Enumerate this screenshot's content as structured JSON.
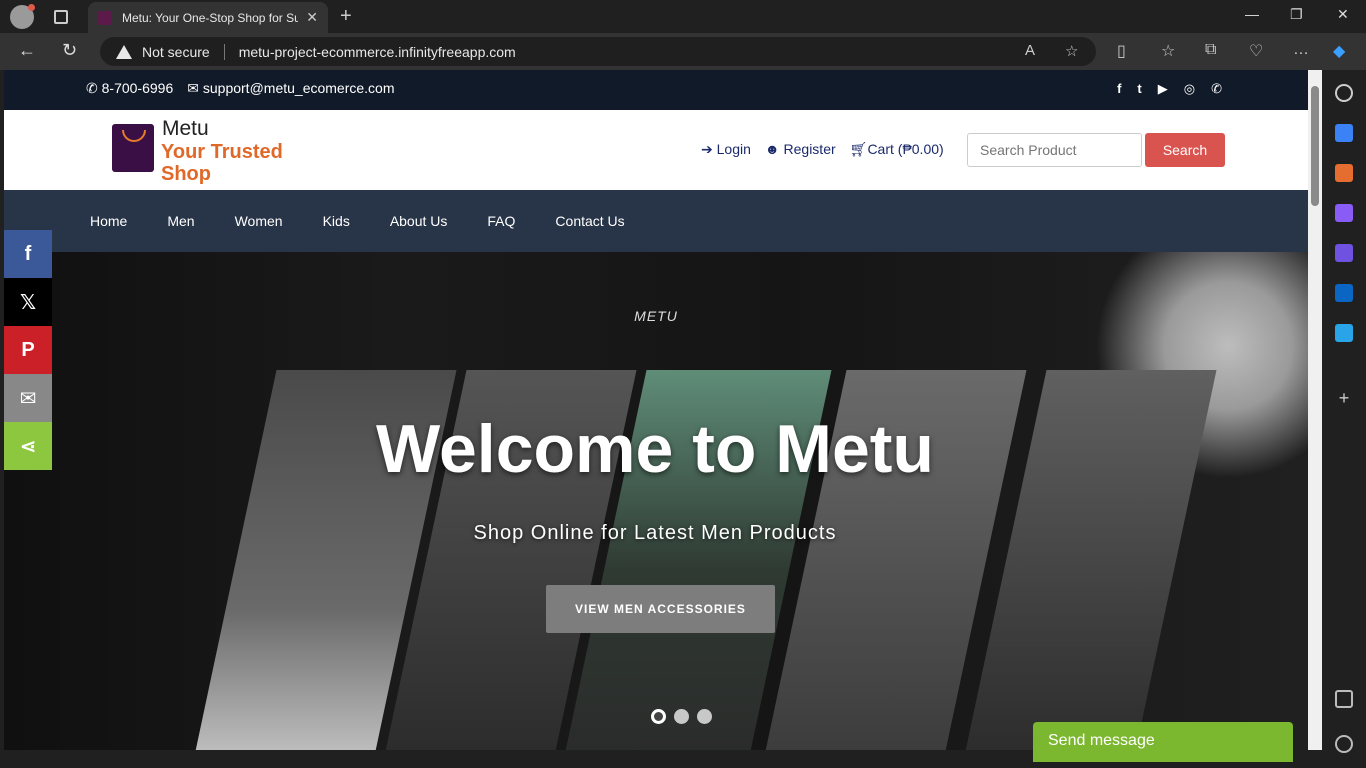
{
  "browser": {
    "tab_title": "Metu: Your One-Stop Shop for Su",
    "security": "Not secure",
    "url": "metu-project-ecommerce.infinityfreeapp.com"
  },
  "topbar": {
    "phone": "8-700-6996",
    "email": "support@metu_ecomerce.com",
    "social_icons": [
      "facebook-icon",
      "twitter-icon",
      "youtube-icon",
      "instagram-icon",
      "whatsapp-icon"
    ]
  },
  "header": {
    "logo_name": "Metu",
    "logo_tagline": "Your Trusted Shop",
    "login": "Login",
    "register": "Register",
    "cart": "Cart (₱0.00)",
    "search_placeholder": "Search Product",
    "search_button": "Search",
    "accent_color": "#d9534f"
  },
  "nav": {
    "items": [
      {
        "label": "Home"
      },
      {
        "label": "Men"
      },
      {
        "label": "Women"
      },
      {
        "label": "Kids"
      },
      {
        "label": "About Us"
      },
      {
        "label": "FAQ"
      },
      {
        "label": "Contact Us"
      }
    ]
  },
  "hero": {
    "kicker": "METU",
    "title": "Welcome to Metu",
    "subtitle": "Shop Online for Latest Men Products",
    "button": "VIEW MEN ACCESSORIES",
    "slide_count": 3,
    "active_slide": 1
  },
  "share_bar": {
    "items": [
      {
        "icon": "facebook-icon",
        "color": "#3b5998",
        "glyph": "f"
      },
      {
        "icon": "x-icon",
        "color": "#000000",
        "glyph": "𝕏"
      },
      {
        "icon": "pinterest-icon",
        "color": "#cb2027",
        "glyph": "P"
      },
      {
        "icon": "email-icon",
        "color": "#888888",
        "glyph": "✉"
      },
      {
        "icon": "share-icon",
        "color": "#8dc63f",
        "glyph": "⋖"
      }
    ]
  },
  "chat": {
    "label": "Send message",
    "color": "#7cb82f"
  }
}
